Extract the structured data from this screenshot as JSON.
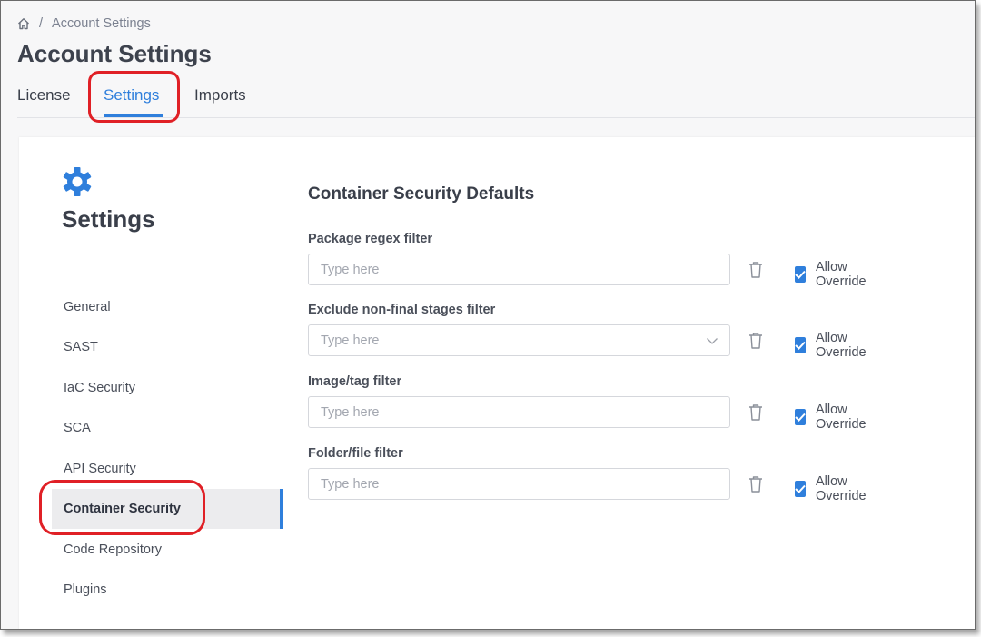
{
  "breadcrumb": {
    "current": "Account Settings",
    "separator": "/"
  },
  "page_title": "Account Settings",
  "tabs": [
    {
      "label": "License"
    },
    {
      "label": "Settings",
      "active": true
    },
    {
      "label": "Imports"
    }
  ],
  "sidebar": {
    "title": "Settings",
    "items": [
      {
        "label": "General"
      },
      {
        "label": "SAST"
      },
      {
        "label": "IaC Security"
      },
      {
        "label": "SCA"
      },
      {
        "label": "API Security"
      },
      {
        "label": "Container Security",
        "active": true
      },
      {
        "label": "Code Repository"
      },
      {
        "label": "Plugins"
      }
    ]
  },
  "content": {
    "title": "Container Security Defaults",
    "fields": [
      {
        "label": "Package regex filter",
        "placeholder": "Type here",
        "value": "",
        "override_label": "Allow Override",
        "override_checked": true
      },
      {
        "label": "Exclude non-final stages filter",
        "placeholder": "Type here",
        "value": "",
        "override_label": "Allow Override",
        "override_checked": true,
        "type": "select"
      },
      {
        "label": "Image/tag filter",
        "placeholder": "Type here",
        "value": "",
        "override_label": "Allow Override",
        "override_checked": true
      },
      {
        "label": "Folder/file filter",
        "placeholder": "Type here",
        "value": "",
        "override_label": "Allow Override",
        "override_checked": true
      }
    ]
  },
  "colors": {
    "accent": "#2f7fdc",
    "highlight": "#e02026",
    "text": "#3a3f4a"
  },
  "icons": {
    "home": "home-icon",
    "settings": "gear-icon",
    "delete": "trash-icon",
    "dropdown": "chevron-down-icon",
    "check": "check-icon"
  }
}
